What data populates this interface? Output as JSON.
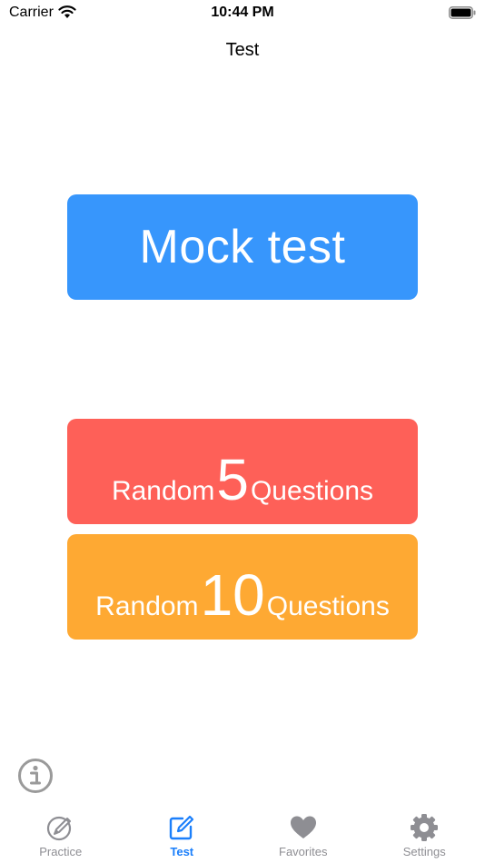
{
  "status_bar": {
    "carrier": "Carrier",
    "time": "10:44 PM"
  },
  "nav": {
    "title": "Test"
  },
  "buttons": {
    "mock_test": "Mock test",
    "random5": {
      "prefix": "Random",
      "number": "5",
      "suffix": "Questions"
    },
    "random10": {
      "prefix": "Random",
      "number": "10",
      "suffix": "Questions"
    }
  },
  "colors": {
    "mock_test": "#3796fc",
    "random5": "#fe6058",
    "random10": "#fea933",
    "tab_active": "#1b7ffb",
    "tab_inactive": "#8e8e93"
  },
  "info": {
    "icon": "info-icon"
  },
  "tab_bar": {
    "tabs": [
      {
        "label": "Practice",
        "icon": "practice-icon",
        "active": false
      },
      {
        "label": "Test",
        "icon": "test-icon",
        "active": true
      },
      {
        "label": "Favorites",
        "icon": "heart-icon",
        "active": false
      },
      {
        "label": "Settings",
        "icon": "gear-icon",
        "active": false
      }
    ]
  }
}
